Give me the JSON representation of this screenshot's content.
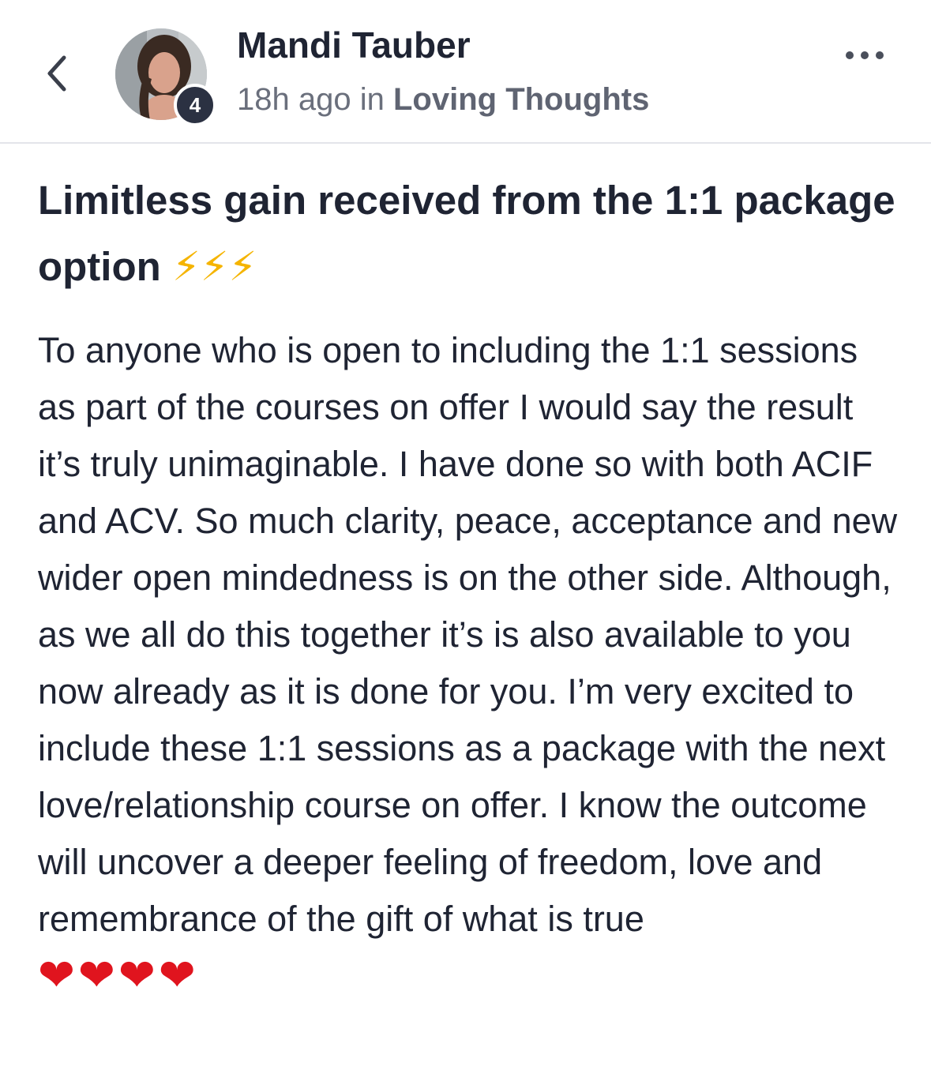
{
  "header": {
    "back_icon": "chevron-left-icon",
    "author_name": "Mandi Tauber",
    "level_badge": "4",
    "time_ago": "18h ago",
    "in_label": "in",
    "group_name": "Loving Thoughts",
    "more_icon": "more-horizontal-icon"
  },
  "post": {
    "title": "Limitless gain received from the 1:1 package option",
    "title_emoji": "⚡⚡⚡",
    "body": "To anyone who is open to including the 1:1 sessions as part of the courses on offer I would say the result it’s truly unimaginable. I have done so with both ACIF and ACV. So much clarity, peace, acceptance and new wider open mindedness is on the other side. Although, as we all do this together it’s is also available to you now already as it is done for you. I’m very excited to include these 1:1 sessions as a package with the next love/relationship course on offer. I know the outcome will uncover a deeper feeling of freedom, love and remembrance of the gift of what is true",
    "body_emoji": "❤❤❤❤"
  },
  "colors": {
    "text_primary": "#1f2433",
    "text_secondary": "#6a6f7c",
    "badge_bg": "#2b3142",
    "divider": "#e3e5ea",
    "bolt": "#f5b400",
    "heart": "#e0141e"
  }
}
